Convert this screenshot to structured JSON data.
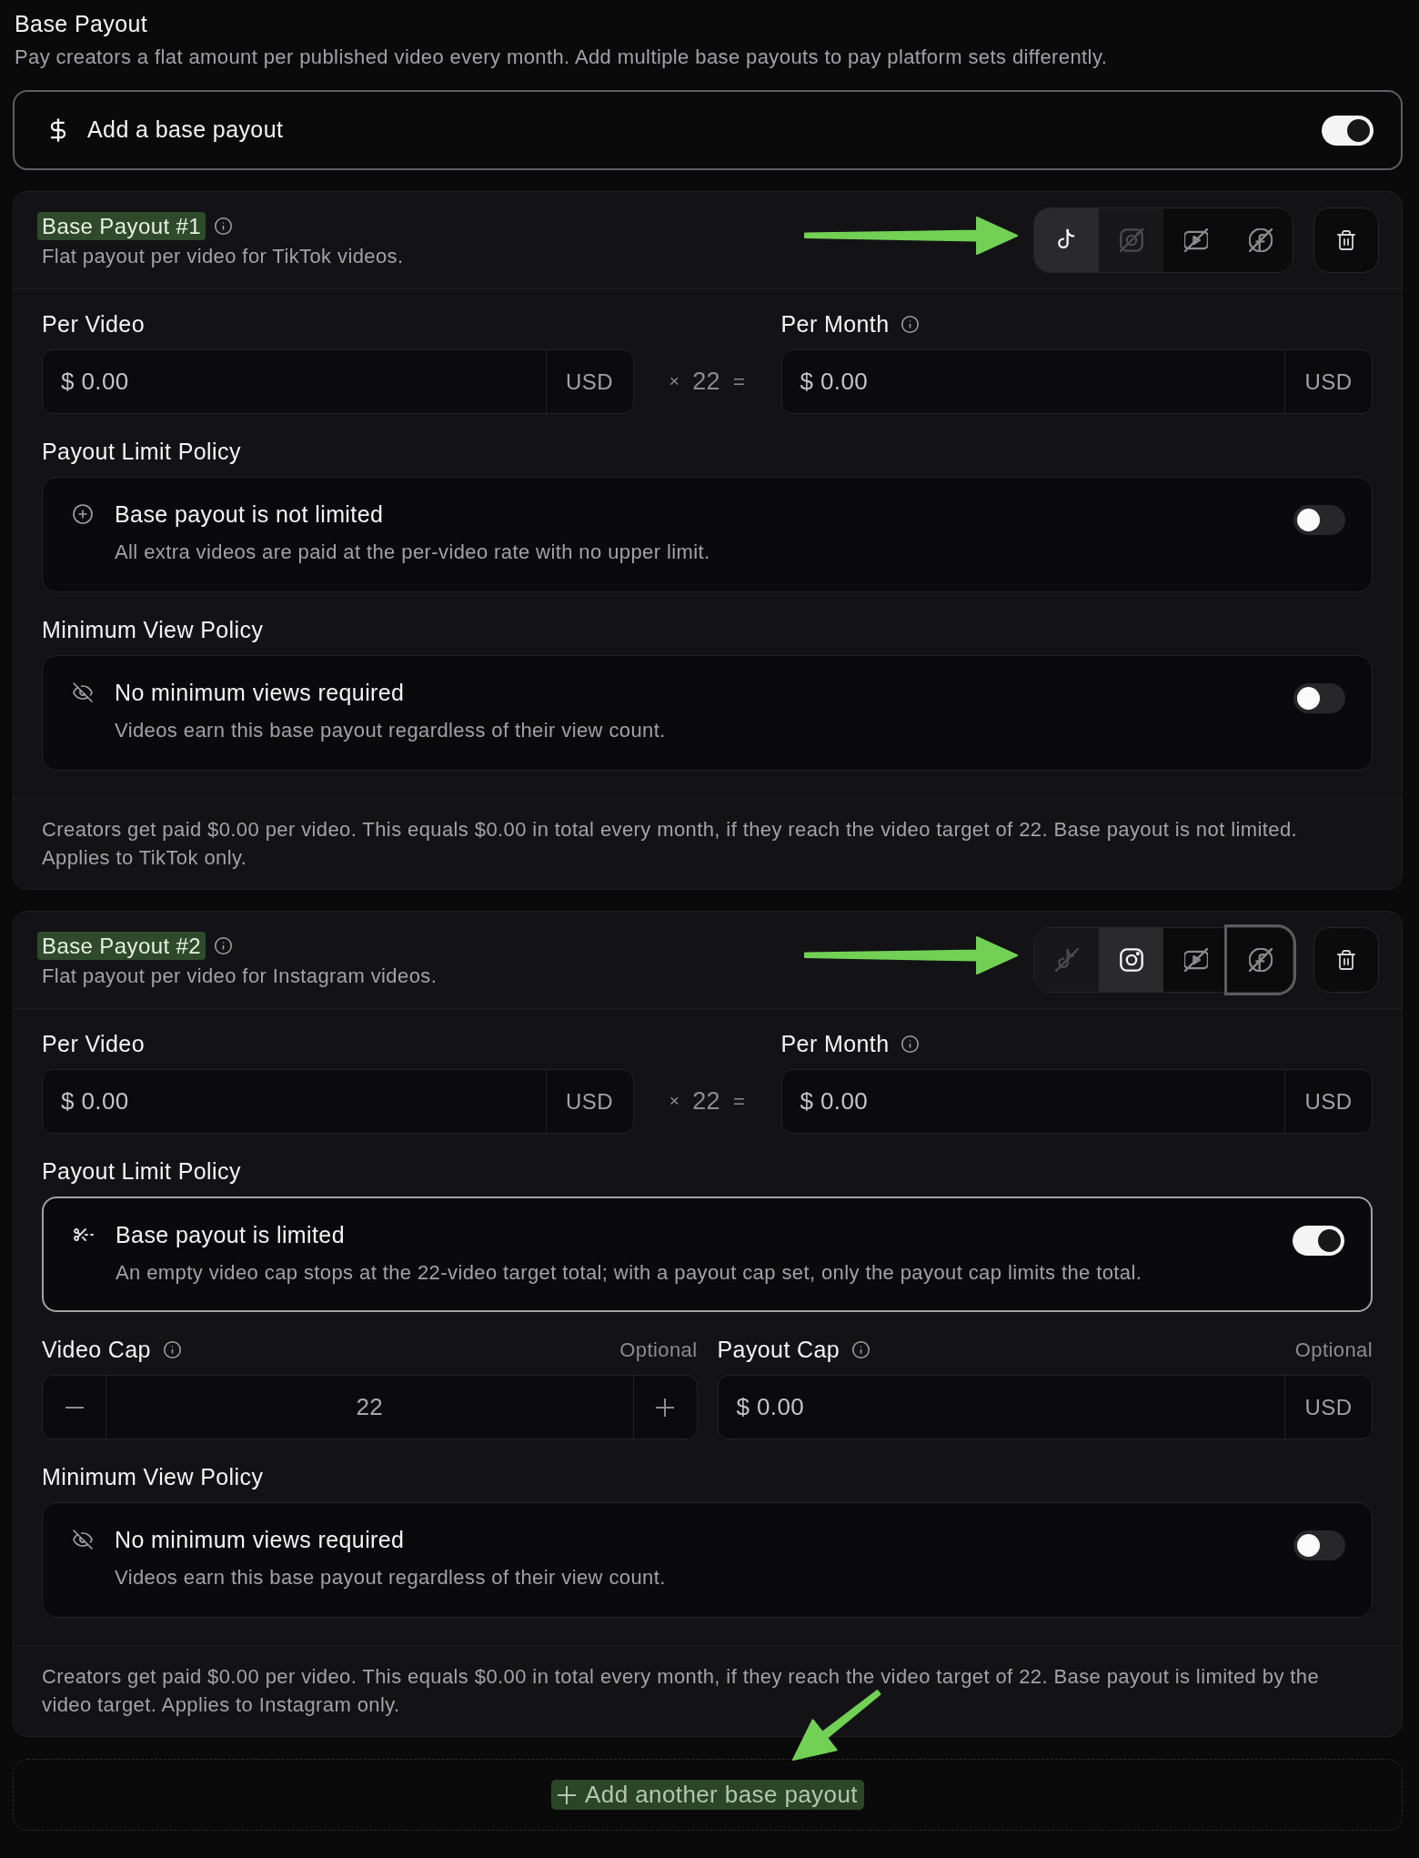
{
  "section": {
    "title": "Base Payout",
    "description": "Pay creators a flat amount per published video every month. Add multiple base payouts to pay platform sets differently."
  },
  "master_toggle": {
    "label": "Add a base payout",
    "on": true
  },
  "payouts": [
    {
      "title": "Base Payout #1",
      "highlighted": true,
      "subtitle": "Flat payout per video for TikTok videos.",
      "pointer_arrow": true,
      "platforms": [
        {
          "kind": "tiktok",
          "selected": true,
          "disabled": false,
          "focused": false
        },
        {
          "kind": "instagram",
          "selected": false,
          "disabled": true,
          "focused": false
        },
        {
          "kind": "youtube",
          "selected": false,
          "disabled": false,
          "focused": false
        },
        {
          "kind": "facebook",
          "selected": false,
          "disabled": false,
          "focused": false
        }
      ],
      "per_video": {
        "label": "Per Video",
        "placeholder": "$ 0.00",
        "unit": "USD"
      },
      "multiplier": {
        "times": "×",
        "count": "22",
        "equals": "="
      },
      "per_month": {
        "label": "Per Month",
        "placeholder": "$ 0.00",
        "unit": "USD"
      },
      "limit_policy": {
        "label": "Payout Limit Policy",
        "title": "Base payout is not limited",
        "description": "All extra videos are paid at the per-video rate with no upper limit.",
        "on": false
      },
      "view_policy": {
        "label": "Minimum View Policy",
        "title": "No minimum views required",
        "description": "Videos earn this base payout regardless of their view count.",
        "on": false
      },
      "summary": "Creators get paid $0.00 per video. This equals $0.00 in total every month, if they reach the video target of 22. Base payout is not limited. Applies to TikTok only."
    },
    {
      "title": "Base Payout #2",
      "highlighted": true,
      "subtitle": "Flat payout per video for Instagram videos.",
      "pointer_arrow": true,
      "platforms": [
        {
          "kind": "tiktok",
          "selected": false,
          "disabled": true,
          "focused": false
        },
        {
          "kind": "instagram",
          "selected": true,
          "disabled": false,
          "focused": false
        },
        {
          "kind": "youtube",
          "selected": false,
          "disabled": false,
          "focused": false
        },
        {
          "kind": "facebook",
          "selected": false,
          "disabled": false,
          "focused": true
        }
      ],
      "per_video": {
        "label": "Per Video",
        "placeholder": "$ 0.00",
        "unit": "USD"
      },
      "multiplier": {
        "times": "×",
        "count": "22",
        "equals": "="
      },
      "per_month": {
        "label": "Per Month",
        "placeholder": "$ 0.00",
        "unit": "USD"
      },
      "limit_policy": {
        "label": "Payout Limit Policy",
        "title": "Base payout is limited",
        "description": "An empty video cap stops at the 22-video target total; with a payout cap set, only the payout cap limits the total.",
        "on": true
      },
      "caps": {
        "video_cap": {
          "label": "Video Cap",
          "hint": "Optional",
          "placeholder": "22"
        },
        "payout_cap": {
          "label": "Payout Cap",
          "hint": "Optional",
          "placeholder": "$ 0.00",
          "unit": "USD"
        }
      },
      "view_policy": {
        "label": "Minimum View Policy",
        "title": "No minimum views required",
        "description": "Videos earn this base payout regardless of their view count.",
        "on": false
      },
      "summary": "Creators get paid $0.00 per video. This equals $0.00 in total every month, if they reach the video target of 22. Base payout is limited by the video target. Applies to Instagram only."
    }
  ],
  "add_button": {
    "label": "Add another base payout",
    "highlighted": true,
    "pointer_arrow": true
  }
}
